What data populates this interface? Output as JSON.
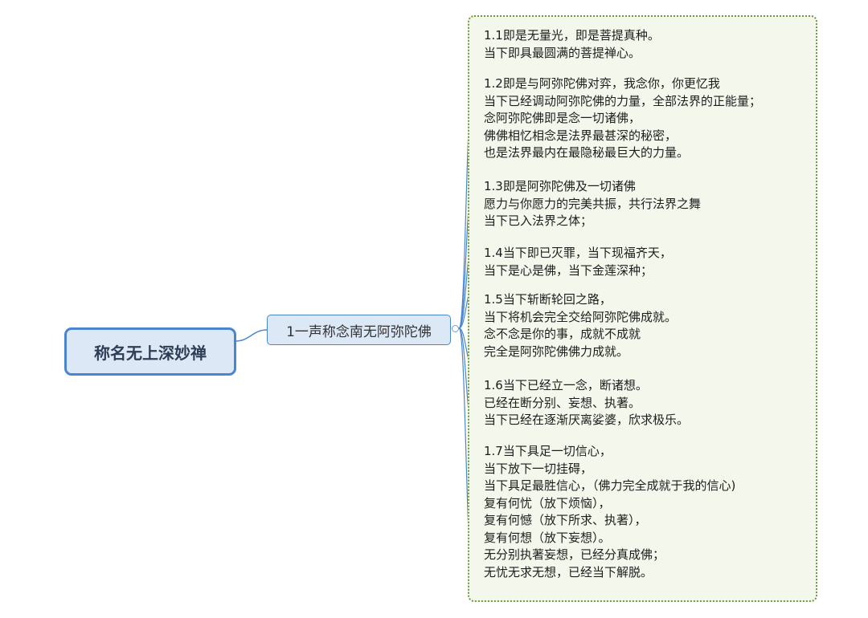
{
  "root": {
    "label": "称名无上深妙禅"
  },
  "branch": {
    "label": "1一声称念南无阿弥陀佛"
  },
  "leaves": [
    {
      "lines": [
        "1.1即是无量光，即是菩提真种。",
        "当下即具最圆满的菩提禅心。"
      ]
    },
    {
      "lines": [
        "1.2即是与阿弥陀佛对弈，我念你，你更忆我",
        "当下已经调动阿弥陀佛的力量，全部法界的正能量；",
        "念阿弥陀佛即是念一切诸佛，",
        "佛佛相忆相念是法界最甚深的秘密，",
        "也是法界最内在最隐秘最巨大的力量。"
      ]
    },
    {
      "lines": [
        "1.3即是阿弥陀佛及一切诸佛",
        "愿力与你愿力的完美共振，共行法界之舞",
        "当下已入法界之体；"
      ]
    },
    {
      "lines": [
        "1.4当下即已灭罪，当下现福齐天，",
        "当下是心是佛，当下金莲深种；"
      ]
    },
    {
      "lines": [
        "1.5当下斩断轮回之路，",
        "当下将机会完全交给阿弥陀佛成就。",
        "念不念是你的事，成就不成就",
        "完全是阿弥陀佛佛力成就。"
      ]
    },
    {
      "lines": [
        "1.6当下已经立一念，断诸想。",
        "已经在断分别、妄想、执著。",
        "当下已经在逐渐厌离娑婆，欣求极乐。"
      ]
    },
    {
      "lines": [
        "1.7当下具足一切信心，",
        "当下放下一切挂碍，",
        "当下具足最胜信心，（佛力完全成就于我的信心)",
        "复有何忧（放下烦恼），",
        "复有何憾（放下所求、执著），",
        "复有何想（放下妄想）。",
        "无分别执著妄想，已经分真成佛；",
        "无忧无求无想，已经当下解脱。"
      ]
    }
  ],
  "colors": {
    "line": "#4a86cf",
    "node_fill": "#dde8f6",
    "summary_border": "#6f9a3c",
    "summary_fill": "#f3f7ec"
  }
}
